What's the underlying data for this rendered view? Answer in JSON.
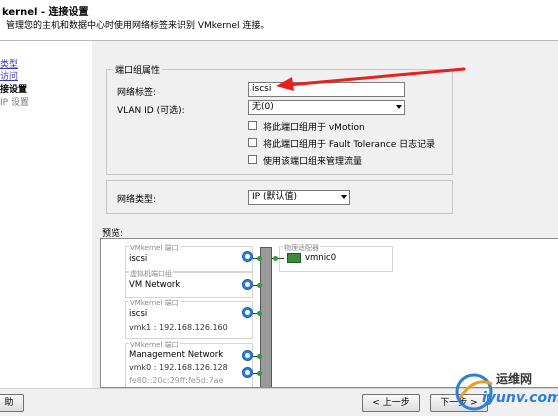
{
  "header": {
    "title": "kernel - 连接设置",
    "description": "管理您的主机和数据中心时使用网络标签来识别 VMkernel 连接。"
  },
  "sidebar": {
    "items": [
      {
        "label": "类型",
        "state": "link"
      },
      {
        "label": "访问",
        "state": "link"
      },
      {
        "label": "接设置",
        "state": "current"
      },
      {
        "label": "IP 设置",
        "state": "next"
      },
      {
        "label": "",
        "state": "next"
      }
    ]
  },
  "port_group_properties": {
    "group_title": "端口组属性",
    "network_label": {
      "label": "网络标签:",
      "value": "iscsi"
    },
    "vlan": {
      "label": "VLAN ID (可选):",
      "value": "无(0)"
    },
    "checkboxes": [
      {
        "label": "将此端口组用于 vMotion",
        "checked": false
      },
      {
        "label": "将此端口组用于 Fault Tolerance 日志记录",
        "checked": false
      },
      {
        "label": "使用该端口组来管理流量",
        "checked": false
      }
    ]
  },
  "network_type": {
    "label": "网络类型:",
    "value": "IP (默认值)"
  },
  "preview": {
    "label": "预览:",
    "switch_label": "物理适配器",
    "adapter_name": "vmnic0",
    "port_groups": [
      {
        "title": "VMkernel 端口",
        "name": "iscsi",
        "detail": ""
      },
      {
        "title": "虚拟机端口组",
        "name": "VM Network",
        "detail": ""
      },
      {
        "title": "VMkernel 端口",
        "name": "iscsi",
        "detail": "vmk1 : 192.168.126.160"
      },
      {
        "title": "VMkernel 端口",
        "name": "Management Network",
        "detail": "vmk0 : 192.168.126.128"
      }
    ],
    "truncated_text": "fe80::20c:29ff:fe5d:7ae"
  },
  "footer": {
    "help_label": "助",
    "back_label": "< 上一步",
    "next_label": "下一步 >"
  },
  "watermark": {
    "site_name": "运维网",
    "site_domain": "iyunv.com"
  },
  "colors": {
    "arrow": "#e8211c",
    "accent_blue": "#2d7fd6",
    "link": "#3a3ab5"
  }
}
